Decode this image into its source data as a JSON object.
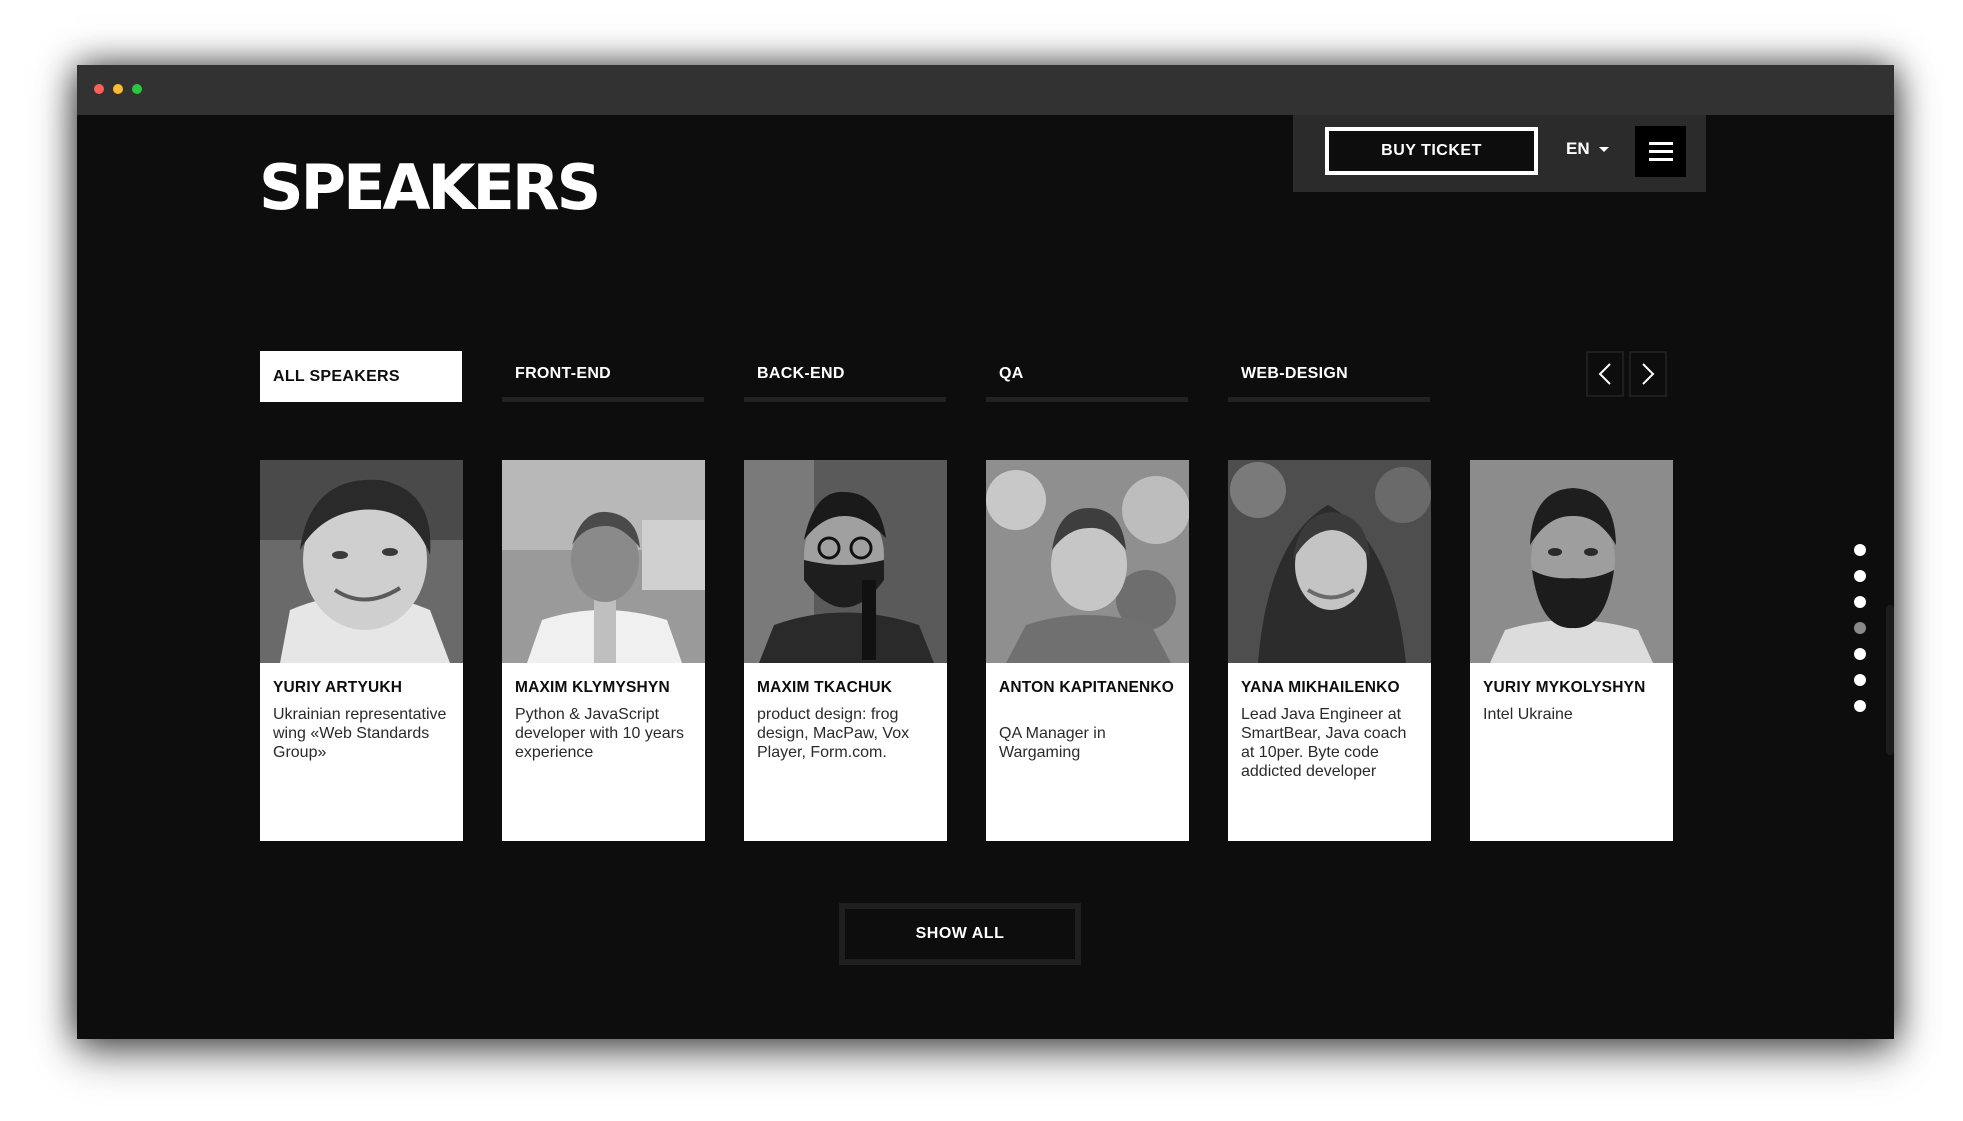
{
  "page": {
    "title": "SPEAKERS"
  },
  "header": {
    "buy_ticket_label": "BUY TICKET",
    "language": "EN",
    "menu_icon": "hamburger-icon"
  },
  "tabs": [
    {
      "label": "ALL SPEAKERS",
      "active": true
    },
    {
      "label": "FRONT-END",
      "active": false
    },
    {
      "label": "BACK-END",
      "active": false
    },
    {
      "label": "QA",
      "active": false
    },
    {
      "label": "WEB-DESIGN",
      "active": false
    }
  ],
  "nav_icons": {
    "prev": "chevron-left-icon",
    "next": "chevron-right-icon"
  },
  "speakers": [
    {
      "name": "YURIY ARTYUKH",
      "description": "Ukrainian representative wing «Web Standards Group»"
    },
    {
      "name": "MAXIM KLYMYSHYN",
      "description": "Python & JavaScript developer with 10 years experience"
    },
    {
      "name": "MAXIM TKACHUK",
      "description": "product design: frog design, MacPaw, Vox Player, Form.com."
    },
    {
      "name": "ANTON KAPITANENKO",
      "description": "QA Manager in Wargaming"
    },
    {
      "name": "YANA MIKHAILENKO",
      "description": "Lead Java Engineer at SmartBear, Java coach at 10per. Byte code addicted developer"
    },
    {
      "name": "YURIY MYKOLYSHYN",
      "description": "Intel Ukraine"
    }
  ],
  "show_all_label": "SHOW ALL",
  "section_pager": {
    "count": 7,
    "active_index": 3
  },
  "colors": {
    "background": "#0d0d0d",
    "titlebar": "#323232",
    "card": "#ffffff",
    "accent": "#ffffff"
  }
}
